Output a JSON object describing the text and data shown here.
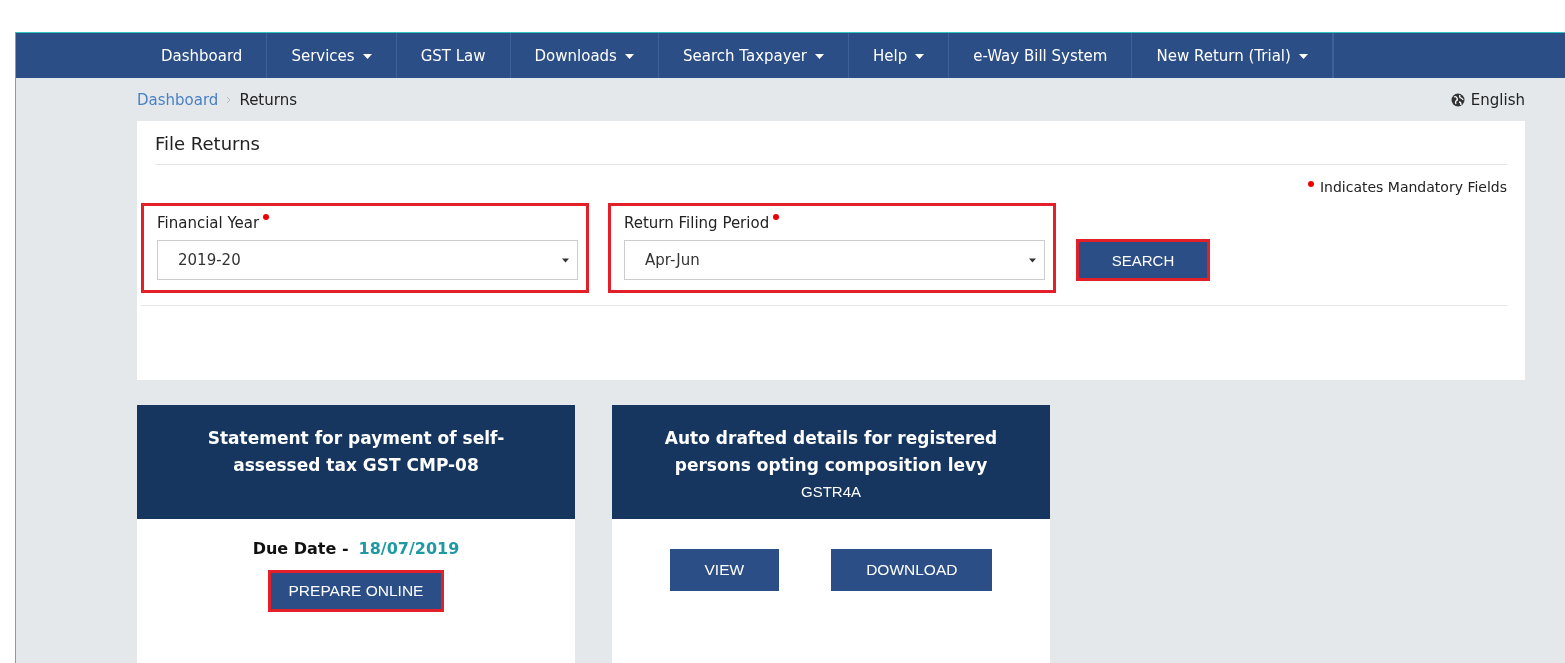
{
  "nav": {
    "items": [
      {
        "label": "Dashboard",
        "dropdown": false
      },
      {
        "label": "Services",
        "dropdown": true
      },
      {
        "label": "GST Law",
        "dropdown": false
      },
      {
        "label": "Downloads",
        "dropdown": true
      },
      {
        "label": "Search Taxpayer",
        "dropdown": true
      },
      {
        "label": "Help",
        "dropdown": true
      },
      {
        "label": "e-Way Bill System",
        "dropdown": false
      },
      {
        "label": "New Return (Trial)",
        "dropdown": true
      }
    ]
  },
  "breadcrumb": [
    {
      "label": "Dashboard",
      "kind": "link"
    },
    {
      "label": "Returns",
      "kind": "current"
    }
  ],
  "language": "English",
  "panel": {
    "title": "File Returns",
    "mandatory_note": "Indicates Mandatory Fields",
    "fields": [
      {
        "label": "Financial Year",
        "required": true,
        "value": "2019-20",
        "highlighted": true
      },
      {
        "label": "Return Filing Period",
        "required": true,
        "value": "Apr-Jun",
        "highlighted": true
      }
    ],
    "search_button": {
      "label": "SEARCH",
      "highlighted": true
    }
  },
  "cards": [
    {
      "title": "Statement for payment of self-assessed tax GST CMP-08",
      "due_label": "Due Date -",
      "due_date": "18/07/2019",
      "buttons": [
        {
          "label": "PREPARE ONLINE",
          "highlighted": true
        }
      ]
    },
    {
      "title": "Auto drafted details for registered persons opting composition levy",
      "subtitle": "GSTR4A",
      "buttons": [
        {
          "label": "VIEW",
          "highlighted": false
        },
        {
          "label": "DOWNLOAD",
          "highlighted": false
        }
      ]
    }
  ]
}
